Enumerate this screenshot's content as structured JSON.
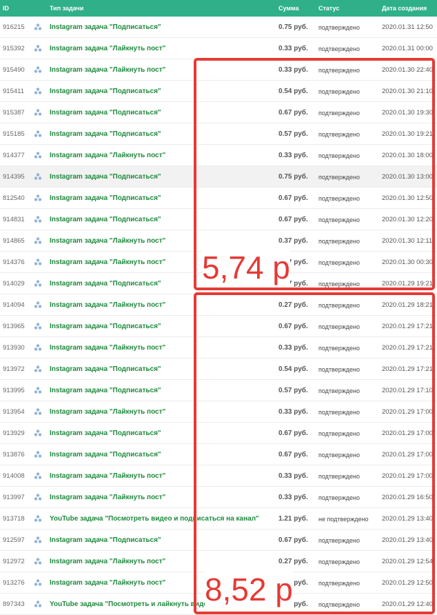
{
  "headers": {
    "id": "ID",
    "type": "Тип задачи",
    "sum": "Сумма",
    "status": "Статус",
    "date": "Дата создания"
  },
  "colors": {
    "header_bg": "#2fb089",
    "link": "#1e8a3c",
    "annotation": "#e53a35"
  },
  "rows": [
    {
      "id": "916215",
      "type": "Instagram задача \"Подписаться\"",
      "sum": "0.75 руб.",
      "status": "подтверждено",
      "date": "2020.01.31 12:50"
    },
    {
      "id": "915392",
      "type": "Instagram задача \"Лайкнуть пост\"",
      "sum": "0.33 руб.",
      "status": "подтверждено",
      "date": "2020.01.31 00:00"
    },
    {
      "id": "915490",
      "type": "Instagram задача \"Лайкнуть пост\"",
      "sum": "0.33 руб.",
      "status": "подтверждено",
      "date": "2020.01.30 22:40"
    },
    {
      "id": "915411",
      "type": "Instagram задача \"Подписаться\"",
      "sum": "0.54 руб.",
      "status": "подтверждено",
      "date": "2020.01.30 21:10"
    },
    {
      "id": "915387",
      "type": "Instagram задача \"Подписаться\"",
      "sum": "0.67 руб.",
      "status": "подтверждено",
      "date": "2020.01.30 19:30"
    },
    {
      "id": "915185",
      "type": "Instagram задача \"Подписаться\"",
      "sum": "0.57 руб.",
      "status": "подтверждено",
      "date": "2020.01.30 19:21"
    },
    {
      "id": "914377",
      "type": "Instagram задача \"Лайкнуть пост\"",
      "sum": "0.33 руб.",
      "status": "подтверждено",
      "date": "2020.01.30 18:00"
    },
    {
      "id": "914395",
      "type": "Instagram задача \"Подписаться\"",
      "sum": "0.75 руб.",
      "status": "подтверждено",
      "date": "2020.01.30 13:00"
    },
    {
      "id": "812540",
      "type": "Instagram задача \"Подписаться\"",
      "sum": "0.67 руб.",
      "status": "подтверждено",
      "date": "2020.01.30 12:50"
    },
    {
      "id": "914831",
      "type": "Instagram задача \"Подписаться\"",
      "sum": "0.67 руб.",
      "status": "подтверждено",
      "date": "2020.01.30 12:20"
    },
    {
      "id": "914865",
      "type": "Instagram задача \"Лайкнуть пост\"",
      "sum": "0.37 руб.",
      "status": "подтверждено",
      "date": "2020.01.30 12:11"
    },
    {
      "id": "914376",
      "type": "Instagram задача \"Лайкнуть пост\"",
      "sum": "0.27 руб.",
      "status": "подтверждено",
      "date": "2020.01.30 00:30"
    },
    {
      "id": "914029",
      "type": "Instagram задача \"Подписаться\"",
      "sum": "0.57 руб.",
      "status": "подтверждено",
      "date": "2020.01.29 19:21"
    },
    {
      "id": "914094",
      "type": "Instagram задача \"Лайкнуть пост\"",
      "sum": "0.27 руб.",
      "status": "подтверждено",
      "date": "2020.01.29 18:21"
    },
    {
      "id": "913965",
      "type": "Instagram задача \"Подписаться\"",
      "sum": "0.67 руб.",
      "status": "подтверждено",
      "date": "2020.01.29 17:21"
    },
    {
      "id": "913930",
      "type": "Instagram задача \"Лайкнуть пост\"",
      "sum": "0.33 руб.",
      "status": "подтверждено",
      "date": "2020.01.29 17:21"
    },
    {
      "id": "913972",
      "type": "Instagram задача \"Подписаться\"",
      "sum": "0.54 руб.",
      "status": "подтверждено",
      "date": "2020.01.29 17:21"
    },
    {
      "id": "913995",
      "type": "Instagram задача \"Подписаться\"",
      "sum": "0.57 руб.",
      "status": "подтверждено",
      "date": "2020.01.29 17:10"
    },
    {
      "id": "913954",
      "type": "Instagram задача \"Лайкнуть пост\"",
      "sum": "0.33 руб.",
      "status": "подтверждено",
      "date": "2020.01.29 17:00"
    },
    {
      "id": "913929",
      "type": "Instagram задача \"Подписаться\"",
      "sum": "0.67 руб.",
      "status": "подтверждено",
      "date": "2020.01.29 17:00"
    },
    {
      "id": "913876",
      "type": "Instagram задача \"Подписаться\"",
      "sum": "0.67 руб.",
      "status": "подтверждено",
      "date": "2020.01.29 17:00"
    },
    {
      "id": "914008",
      "type": "Instagram задача \"Лайкнуть пост\"",
      "sum": "0.33 руб.",
      "status": "подтверждено",
      "date": "2020.01.29 17:00"
    },
    {
      "id": "913997",
      "type": "Instagram задача \"Лайкнуть пост\"",
      "sum": "0.33 руб.",
      "status": "подтверждено",
      "date": "2020.01.29 16:50"
    },
    {
      "id": "913718",
      "type": "YouTube задача \"Посмотреть видео и подписаться на канал\"",
      "sum": "1.21 руб.",
      "status": "не подтверждено",
      "date": "2020.01.29 13:40"
    },
    {
      "id": "912597",
      "type": "Instagram задача \"Подписаться\"",
      "sum": "0.67 руб.",
      "status": "подтверждено",
      "date": "2020.01.29 13:40"
    },
    {
      "id": "912972",
      "type": "Instagram задача \"Лайкнуть пост\"",
      "sum": "0.27 руб.",
      "status": "подтверждено",
      "date": "2020.01.29 12:54"
    },
    {
      "id": "913276",
      "type": "Instagram задача \"Лайкнуть пост\"",
      "sum": "0.33 руб.",
      "status": "подтверждено",
      "date": "2020.01.29 12:50"
    },
    {
      "id": "897343",
      "type": "YouTube задача \"Посмотреть и лайкнуть видео\"",
      "sum": "1.33 руб.",
      "status": "подтверждено",
      "date": "2020.01.29 12:40"
    }
  ],
  "annotations": {
    "first_total": "5,74 р",
    "second_total": "8,52 р"
  }
}
